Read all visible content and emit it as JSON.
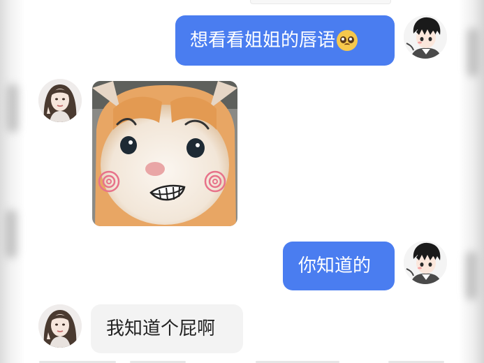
{
  "messages": [
    {
      "side": "right",
      "type": "text",
      "text": "想看看姐姐的唇语",
      "emoji": "pleading-face-emoji"
    },
    {
      "side": "left",
      "type": "sticker",
      "sticker": "cat-sticker"
    },
    {
      "side": "right",
      "type": "text",
      "text": "你知道的"
    },
    {
      "side": "left",
      "type": "text",
      "text": "我知道个屁啊"
    }
  ],
  "colors": {
    "outgoing_bubble": "#4a7df0",
    "incoming_bubble": "#f3f3f3",
    "outgoing_text": "#ffffff",
    "incoming_text": "#222222"
  },
  "avatars": {
    "self": "anime-boy-avatar",
    "other": "girl-photo-avatar"
  }
}
